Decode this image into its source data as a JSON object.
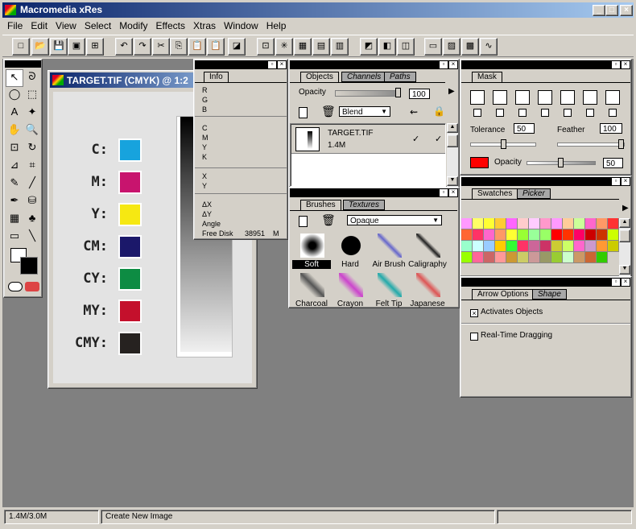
{
  "app": {
    "title": "Macromedia xRes",
    "colors": {
      "title_start": "#0a246a",
      "title_end": "#a6caf0"
    }
  },
  "window_buttons": {
    "minimize": "_",
    "maximize": "□",
    "close": "×"
  },
  "menu": [
    "File",
    "Edit",
    "View",
    "Select",
    "Modify",
    "Effects",
    "Xtras",
    "Window",
    "Help"
  ],
  "toolbar": {
    "icons": [
      "new-file-icon",
      "open-icon",
      "save-icon",
      "document-icon",
      "import-icon",
      "undo-icon",
      "redo-icon",
      "cut-icon",
      "copy-icon",
      "paste-icon",
      "paste-special-icon",
      "resize-icon",
      "fit-selection-icon",
      "center-icon",
      "grid-icon",
      "color-icon",
      "fill-icon",
      "screen-mode-icon",
      "full-screen-icon",
      "window-mode-icon",
      "objects-icon",
      "layers-icon",
      "colors-icon",
      "brush-curve-icon"
    ],
    "glyphs": [
      "□",
      "📂",
      "💾",
      "▣",
      "⊞",
      "↶",
      "↷",
      "✂",
      "⎘",
      "📋",
      "📋",
      "◪",
      "⊡",
      "✳",
      "▦",
      "▤",
      "▥",
      "◩",
      "◧",
      "◫",
      "▭",
      "▨",
      "▩",
      "∿"
    ]
  },
  "document": {
    "title": "TARGET.TIF (CMYK) @ 1:2",
    "swatches": [
      {
        "label": "C:",
        "color": "#17a3dd"
      },
      {
        "label": "M:",
        "color": "#c8146e"
      },
      {
        "label": "Y:",
        "color": "#f6e812"
      },
      {
        "label": "CM:",
        "color": "#1b186a"
      },
      {
        "label": "CY:",
        "color": "#0d8c43"
      },
      {
        "label": "MY:",
        "color": "#c4102c"
      },
      {
        "label": "CMY:",
        "color": "#262220"
      }
    ]
  },
  "info": {
    "tab": "Info",
    "r": "R",
    "g": "G",
    "b": "B",
    "c": "C",
    "m": "M",
    "y": "Y",
    "k": "K",
    "x": "X",
    "y2": "Y",
    "dx": "ΔX",
    "dy": "ΔY",
    "angle": "Angle",
    "free_disk_label": "Free Disk",
    "free_disk_value": "38951",
    "free_disk_unit": "M"
  },
  "objects": {
    "tabs": [
      "Objects",
      "Channels",
      "Paths"
    ],
    "opacity_label": "Opacity",
    "opacity_value": "100",
    "blend": "Blend",
    "item_name": "TARGET.TIF",
    "item_size": "1.4M",
    "check1": "✓",
    "check2": "✓"
  },
  "brushes": {
    "tabs": [
      "Brushes",
      "Textures"
    ],
    "mode": "Opaque",
    "items": [
      "Soft",
      "Hard",
      "Air Brush",
      "Caligraphy",
      "Charcoal",
      "Crayon",
      "Felt Tip",
      "Japanese"
    ]
  },
  "mask": {
    "tab": "Mask",
    "tolerance_label": "Tolerance",
    "tolerance_value": "50",
    "feather_label": "Feather",
    "feather_value": "100",
    "opacity_label": "Opacity",
    "opacity_value": "50",
    "color": "#ff0000"
  },
  "swatches": {
    "tabs": [
      "Swatches",
      "Picker"
    ],
    "colors": [
      "#ff99ff",
      "#ffff66",
      "#ffff33",
      "#ffcc33",
      "#ff66ff",
      "#ffcccc",
      "#ffccff",
      "#ff99cc",
      "#ff99ff",
      "#ffcc99",
      "#ccff99",
      "#ff66cc",
      "#ff9966",
      "#ff3333",
      "#ff6633",
      "#ff3366",
      "#ff66cc",
      "#ff9966",
      "#ffff33",
      "#99ff33",
      "#99ff99",
      "#99ff66",
      "#ff0000",
      "#ff3300",
      "#ff0066",
      "#cc0000",
      "#cc3300",
      "#ccff00",
      "#99ffcc",
      "#ccffff",
      "#99ccff",
      "#ffcc00",
      "#33ff33",
      "#ff3366",
      "#cc6699",
      "#cc3366",
      "#cccc33",
      "#ccff66",
      "#ff66cc",
      "#cc99cc",
      "#ff9933",
      "#cccc00",
      "#99ff00",
      "#ff6699",
      "#cc6666",
      "#ff9999",
      "#cc9933",
      "#cccc66",
      "#cc9999",
      "#999966",
      "#99cc33",
      "#ccffcc",
      "#cc9966",
      "#cc6633",
      "#33cc00"
    ]
  },
  "arrow": {
    "tabs": [
      "Arrow Options",
      "Shape"
    ],
    "activates": "Activates Objects",
    "realtime": "Real-Time Dragging",
    "activates_mark": "×"
  },
  "status": {
    "memory": "1.4M/3.0M",
    "message": "Create New Image"
  },
  "tools": [
    "arrow-icon",
    "lasso-icon",
    "ellipse-marquee-icon",
    "rect-marquee-icon",
    "text-icon",
    "magic-wand-icon",
    "hand-icon",
    "zoom-icon",
    "crop-icon",
    "rotate-icon",
    "distort-icon",
    "trim-icon",
    "eyedropper-icon",
    "line-icon",
    "pen-icon",
    "bucket-icon",
    "gradient-icon",
    "rubber-stamp-icon",
    "eraser-icon",
    "brush-icon"
  ],
  "tool_glyphs": [
    "↖",
    "ᘐ",
    "◯",
    "⬚",
    "A",
    "✦",
    "✋",
    "🔍",
    "⊡",
    "↻",
    "⊿",
    "⌗",
    "✎",
    "╱",
    "✒",
    "⛁",
    "▦",
    "♣",
    "▭",
    "╲"
  ]
}
